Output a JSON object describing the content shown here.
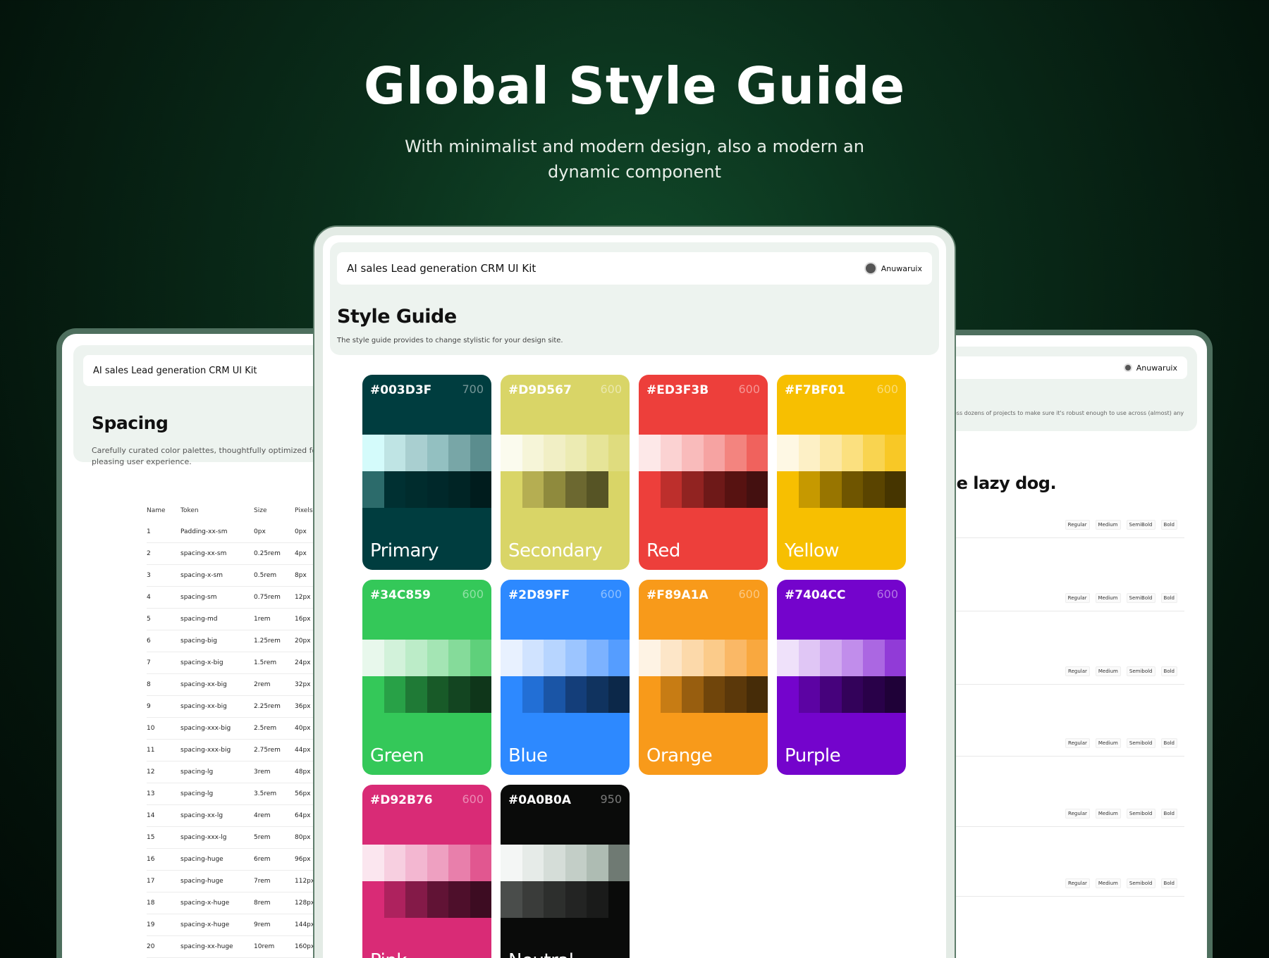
{
  "hero": {
    "title": "Global Style Guide",
    "subtitle": "With minimalist and modern design, also a modern an dynamic component"
  },
  "left_panel": {
    "kit_name": "AI sales Lead generation CRM UI Kit",
    "title": "Spacing",
    "description": "Carefully curated color palettes, thoughtfully optimized for UI elemer pleasing user experience.",
    "columns": [
      "Name",
      "Token",
      "Size",
      "Pixels"
    ],
    "rows": [
      [
        "1",
        "Padding-xx-sm",
        "0px",
        "0px"
      ],
      [
        "2",
        "spacing-xx-sm",
        "0.25rem",
        "4px"
      ],
      [
        "3",
        "spacing-x-sm",
        "0.5rem",
        "8px"
      ],
      [
        "4",
        "spacing-sm",
        "0.75rem",
        "12px"
      ],
      [
        "5",
        "spacing-md",
        "1rem",
        "16px"
      ],
      [
        "6",
        "spacing-big",
        "1.25rem",
        "20px"
      ],
      [
        "7",
        "spacing-x-big",
        "1.5rem",
        "24px"
      ],
      [
        "8",
        "spacing-xx-big",
        "2rem",
        "32px"
      ],
      [
        "9",
        "spacing-xx-big",
        "2.25rem",
        "36px"
      ],
      [
        "10",
        "spacing-xxx-big",
        "2.5rem",
        "40px"
      ],
      [
        "11",
        "spacing-xxx-big",
        "2.75rem",
        "44px"
      ],
      [
        "12",
        "spacing-lg",
        "3rem",
        "48px"
      ],
      [
        "13",
        "spacing-lg",
        "3.5rem",
        "56px"
      ],
      [
        "14",
        "spacing-xx-lg",
        "4rem",
        "64px"
      ],
      [
        "15",
        "spacing-xxx-lg",
        "5rem",
        "80px"
      ],
      [
        "16",
        "spacing-huge",
        "6rem",
        "96px"
      ],
      [
        "17",
        "spacing-huge",
        "7rem",
        "112px"
      ],
      [
        "18",
        "spacing-x-huge",
        "8rem",
        "128px"
      ],
      [
        "19",
        "spacing-x-huge",
        "9rem",
        "144px"
      ],
      [
        "20",
        "spacing-xx-huge",
        "10rem",
        "160px"
      ]
    ]
  },
  "right_panel": {
    "user": "Anuwaruix",
    "description": "e across dozens of projects to make sure it's robust enough to use across (almost) any",
    "sample_text": "he lazy dog.",
    "weights": [
      [
        "Regular",
        "Medium",
        "SemiBold",
        "Bold"
      ],
      [
        "Regular",
        "Medium",
        "SemiBold",
        "Bold"
      ],
      [
        "Regular",
        "Medium",
        "Semibold",
        "Bold"
      ],
      [
        "Regular",
        "Medium",
        "Semibold",
        "Bold"
      ],
      [
        "Regular",
        "Medium",
        "Semibold",
        "Bold"
      ],
      [
        "Regular",
        "Medium",
        "Semibold",
        "Bold"
      ]
    ]
  },
  "front_panel": {
    "kit_name": "AI sales Lead generation CRM UI Kit",
    "user": "Anuwaruix",
    "title": "Style Guide",
    "description": "The style guide provides to change stylistic for your design site.",
    "palettes": [
      {
        "hex": "#003D3F",
        "weight": "700",
        "name": "Primary",
        "base": "#003D3F",
        "light": [
          "#d4fbfb",
          "#bfe4e4",
          "#a9cfd0",
          "#93c0c1",
          "#78a6a7",
          "#5b8d8e"
        ],
        "dark": [
          "#2c6b6b",
          "#003032",
          "#002c2d",
          "#00282a",
          "#002425",
          "#001c1d"
        ]
      },
      {
        "hex": "#D9D567",
        "weight": "600",
        "name": "Secondary",
        "base": "#D9D567",
        "light": [
          "#fbfbee",
          "#f6f5d8",
          "#f1efc5",
          "#ecebb3",
          "#e6e498",
          "#dfdc7e"
        ],
        "dark": [
          "#d9d567",
          "#b5ae52",
          "#8f8a3d",
          "#6c6830",
          "#565425",
          "#d9d567"
        ]
      },
      {
        "hex": "#ED3F3B",
        "weight": "600",
        "name": "Red",
        "base": "#ED3F3B",
        "light": [
          "#fde8e8",
          "#fbd2d2",
          "#f9bbbb",
          "#f6a3a2",
          "#f3847f",
          "#f0625d"
        ],
        "dark": [
          "#ed3f3b",
          "#bd2f2c",
          "#912321",
          "#6e1918",
          "#571211",
          "#441010"
        ]
      },
      {
        "hex": "#F7BF01",
        "weight": "600",
        "name": "Yellow",
        "base": "#F7BF01",
        "light": [
          "#fef8e4",
          "#fdf0c6",
          "#fce8a5",
          "#fbe07f",
          "#f9d450",
          "#f8c826"
        ],
        "dark": [
          "#f7bf01",
          "#c69900",
          "#987500",
          "#6f5500",
          "#5a4400",
          "#463500"
        ]
      },
      {
        "hex": "#34C859",
        "weight": "600",
        "name": "Green",
        "base": "#34C859",
        "light": [
          "#e8f8ec",
          "#d2f2da",
          "#bcecc8",
          "#a4e5b4",
          "#85db9a",
          "#5fd07b"
        ],
        "dark": [
          "#34c859",
          "#28a147",
          "#1f7a36",
          "#185a28",
          "#134521",
          "#0f361a"
        ]
      },
      {
        "hex": "#2D89FF",
        "weight": "600",
        "name": "Blue",
        "base": "#2D89FF",
        "light": [
          "#e8f1ff",
          "#d0e3ff",
          "#b7d5ff",
          "#9cc5ff",
          "#7cb2ff",
          "#559dff"
        ],
        "dark": [
          "#2d89ff",
          "#226fd6",
          "#1a55a6",
          "#143e7a",
          "#10335f",
          "#0c2849"
        ]
      },
      {
        "hex": "#F89A1A",
        "weight": "600",
        "name": "Orange",
        "base": "#F89A1A",
        "light": [
          "#fef3e4",
          "#fde6c8",
          "#fcd9aa",
          "#fbcb8a",
          "#fab866",
          "#f9a83f"
        ],
        "dark": [
          "#f89a1a",
          "#c77c14",
          "#985e0f",
          "#70450b",
          "#5b380a",
          "#462c08"
        ]
      },
      {
        "hex": "#7404CC",
        "weight": "600",
        "name": "Purple",
        "base": "#7404CC",
        "light": [
          "#efe1fa",
          "#e0c6f5",
          "#d1aaf0",
          "#c18deb",
          "#ab67e2",
          "#913bd7"
        ],
        "dark": [
          "#7404cc",
          "#5c03a3",
          "#46027c",
          "#33025a",
          "#290149",
          "#1f0138"
        ]
      },
      {
        "hex": "#D92B76",
        "weight": "600",
        "name": "Pink",
        "base": "#D92B76",
        "light": [
          "#fbe6ef",
          "#f7cfe0",
          "#f3b7d1",
          "#eea0c1",
          "#e87fab",
          "#e15790"
        ],
        "dark": [
          "#d92b76",
          "#ae225e",
          "#841a48",
          "#611335",
          "#4e0f2b",
          "#3d0c22"
        ]
      },
      {
        "hex": "#0A0B0A",
        "weight": "950",
        "name": "Neutral",
        "base": "#0A0B0A",
        "light": [
          "#f4f6f5",
          "#e6ebe8",
          "#d5ddd8",
          "#c3cec7",
          "#aebcb3",
          "#6f7a73"
        ],
        "dark": [
          "#4a4d4b",
          "#3a3c3a",
          "#2d2f2d",
          "#232423",
          "#1a1b1a",
          "#0a0b0a"
        ]
      }
    ]
  }
}
